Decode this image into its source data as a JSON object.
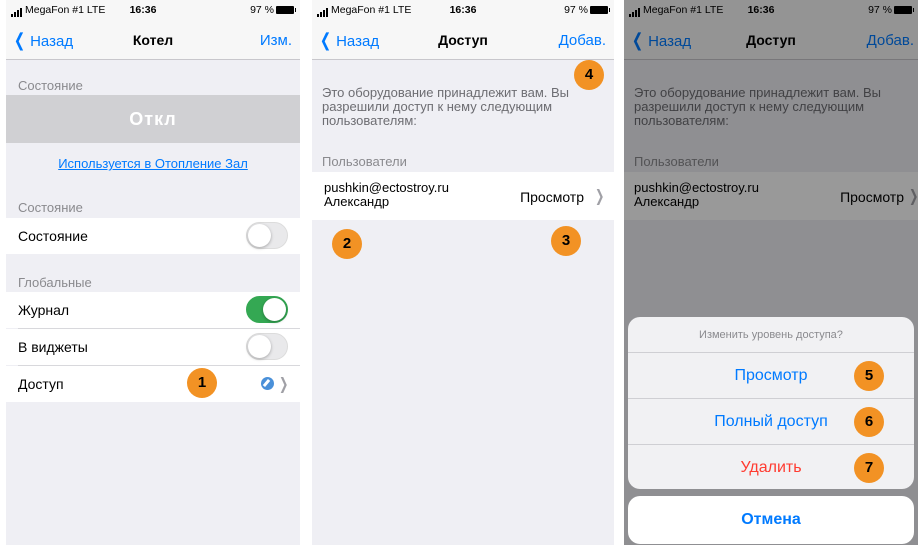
{
  "status": {
    "carrier": "MegaFon #1  LTE",
    "time": "16:36",
    "battery": "97 %"
  },
  "screen1": {
    "back": "Назад",
    "title": "Котел",
    "edit": "Изм.",
    "state_header": "Состояние",
    "state_value": "Откл",
    "used_in_link": "Используется в Отопление Зал",
    "state_header2": "Состояние",
    "state_row": "Состояние",
    "global_header": "Глобальные",
    "journal": "Журнал",
    "widgets": "В виджеты",
    "access": "Доступ",
    "badge": "1"
  },
  "screen2": {
    "back": "Назад",
    "title": "Доступ",
    "add": "Добав.",
    "info": "Это оборудование принадлежит вам. Вы разрешили доступ к нему следующим пользователям:",
    "users_header": "Пользователи",
    "user_email": "pushkin@ectostroy.ru",
    "user_name": "Александр",
    "user_access": "Просмотр",
    "badges": [
      "2",
      "3",
      "4"
    ]
  },
  "screen3": {
    "back": "Назад",
    "title": "Доступ",
    "add": "Добав.",
    "info": "Это оборудование принадлежит вам. Вы разрешили доступ к нему следующим пользователям:",
    "users_header": "Пользователи",
    "user_email": "pushkin@ectostroy.ru",
    "user_name": "Александр",
    "user_access": "Просмотр",
    "sheet_title": "Изменить уровень доступа?",
    "opt_view": "Просмотр",
    "opt_full": "Полный доступ",
    "opt_delete": "Удалить",
    "cancel": "Отмена",
    "badges": [
      "5",
      "6",
      "7"
    ]
  },
  "colors": {
    "accent": "#007aff",
    "badge": "#f29224",
    "switch_on": "#34a853",
    "danger": "#ff3b30"
  },
  "switches": {
    "state": false,
    "journal": true,
    "widgets": false
  }
}
